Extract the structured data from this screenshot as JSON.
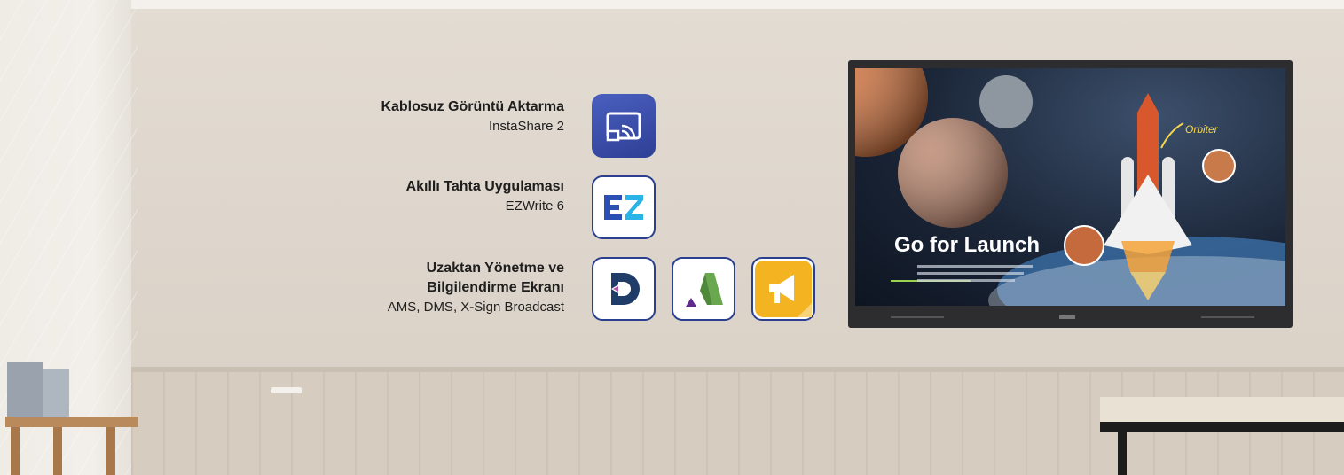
{
  "features": [
    {
      "title": "Kablosuz Görüntü Aktarma",
      "subtitle": "InstaShare 2",
      "icon": "instashare-icon"
    },
    {
      "title": "Akıllı Tahta Uygulaması",
      "subtitle": "EZWrite 6",
      "icon": "ezwrite-icon"
    },
    {
      "title_line1": "Uzaktan Yönetme ve",
      "title_line2": "Bilgilendirme Ekranı",
      "subtitle": "AMS, DMS, X-Sign Broadcast",
      "icons": [
        "dms-icon",
        "ams-icon",
        "xsign-broadcast-icon"
      ]
    }
  ],
  "display": {
    "headline": "Go for Launch",
    "callout": "Orbiter"
  },
  "colors": {
    "instashare_bg": "#3a4ea7",
    "ezwrite_blue": "#2c4fb4",
    "ezwrite_teal": "#2ab3e6",
    "dms_navy": "#1f3d68",
    "ams_green": "#6aa84f",
    "ams_purple": "#5e2b8c",
    "xsign_yellow": "#f4b321",
    "tile_border": "#2a3f8f"
  }
}
